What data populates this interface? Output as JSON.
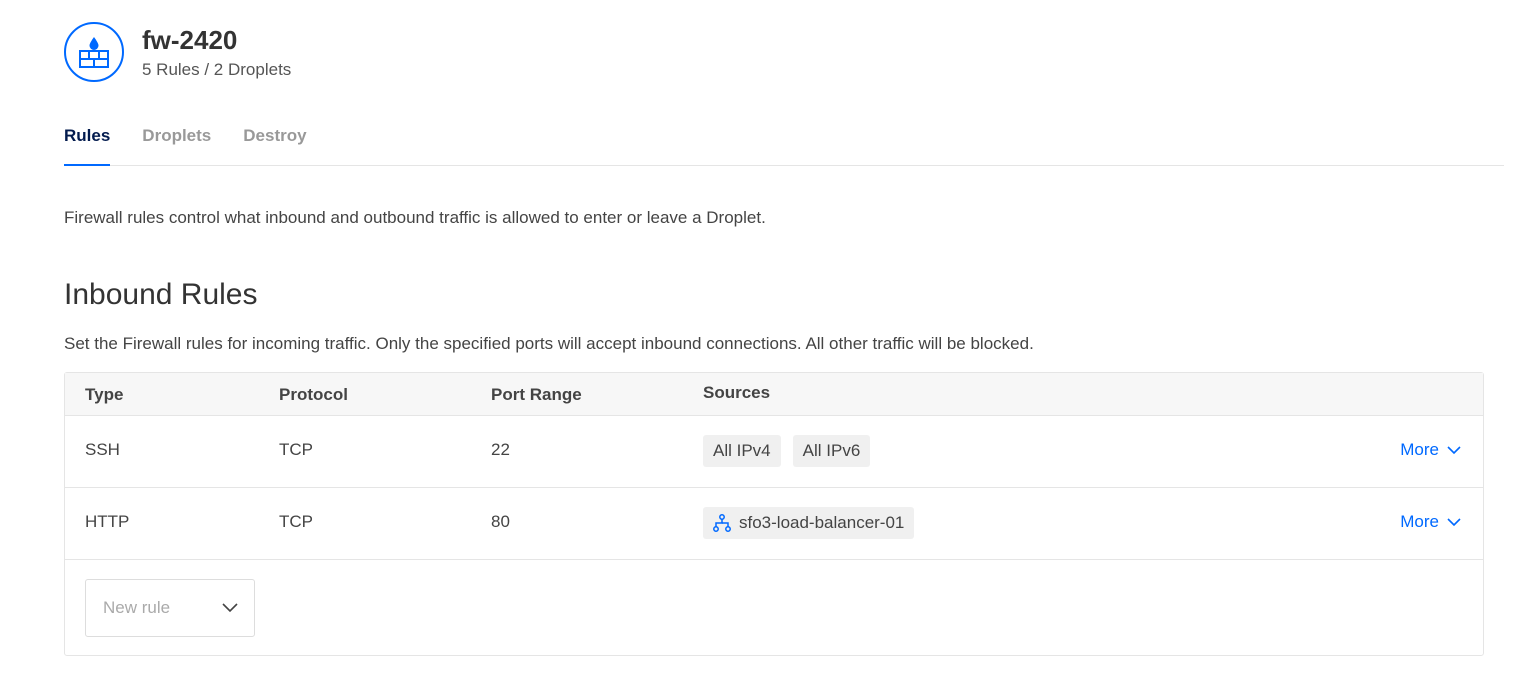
{
  "firewall": {
    "name": "fw-2420",
    "summary": "5 Rules / 2 Droplets"
  },
  "tabs": [
    {
      "label": "Rules",
      "active": true
    },
    {
      "label": "Droplets",
      "active": false
    },
    {
      "label": "Destroy",
      "active": false
    }
  ],
  "intro_text": "Firewall rules control what inbound and outbound traffic is allowed to enter or leave a Droplet.",
  "inbound": {
    "title": "Inbound Rules",
    "description": "Set the Firewall rules for incoming traffic. Only the specified ports will accept inbound connections. All other traffic will be blocked.",
    "columns": {
      "type": "Type",
      "protocol": "Protocol",
      "port_range": "Port Range",
      "sources": "Sources"
    },
    "rows": [
      {
        "type": "SSH",
        "protocol": "TCP",
        "port": "22",
        "sources": [
          "All IPv4",
          "All IPv6"
        ],
        "more": "More"
      },
      {
        "type": "HTTP",
        "protocol": "TCP",
        "port": "80",
        "sources": [
          "sfo3-load-balancer-01"
        ],
        "more": "More"
      }
    ],
    "new_rule_placeholder": "New rule"
  },
  "colors": {
    "accent": "#0069ff",
    "tab_active": "#031b4e",
    "chip_bg": "#f0f0f0"
  },
  "icons": [
    "firewall-icon",
    "load-balancer-icon",
    "chevron-down-icon"
  ]
}
